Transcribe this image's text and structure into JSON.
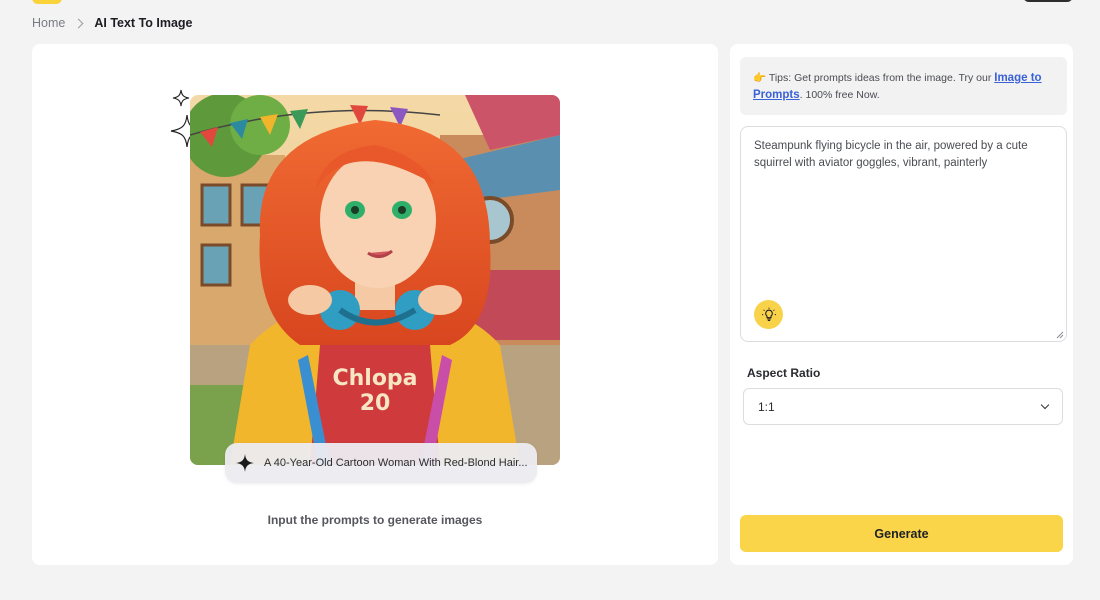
{
  "breadcrumb": {
    "home": "Home",
    "current": "AI Text To Image"
  },
  "preview": {
    "image_caption": "A 40-Year-Old Cartoon Woman With Red-Blond Hair...",
    "hint": "Input the prompts to generate images",
    "artwork_text": "Chlopa 20"
  },
  "panel": {
    "tips_icon": "👉",
    "tips_text": "Tips: Get prompts ideas from the image. Try our",
    "tips_link": "Image to Prompts",
    "tips_suffix": ". 100% free Now.",
    "prompt_value": "Steampunk flying bicycle in the air, powered by a cute squirrel with aviator goggles, vibrant, painterly",
    "aspect_label": "Aspect Ratio",
    "aspect_value": "1:1",
    "generate_label": "Generate"
  },
  "icons": {
    "breadcrumb_separator": "chevron-right-icon",
    "caption": "sparkle-icon",
    "prompt_ideas": "lightbulb-icon",
    "select": "chevron-down-icon"
  },
  "colors": {
    "accent": "#fad54a",
    "link": "#3a62d7",
    "page_bg": "#f3f3f4"
  }
}
